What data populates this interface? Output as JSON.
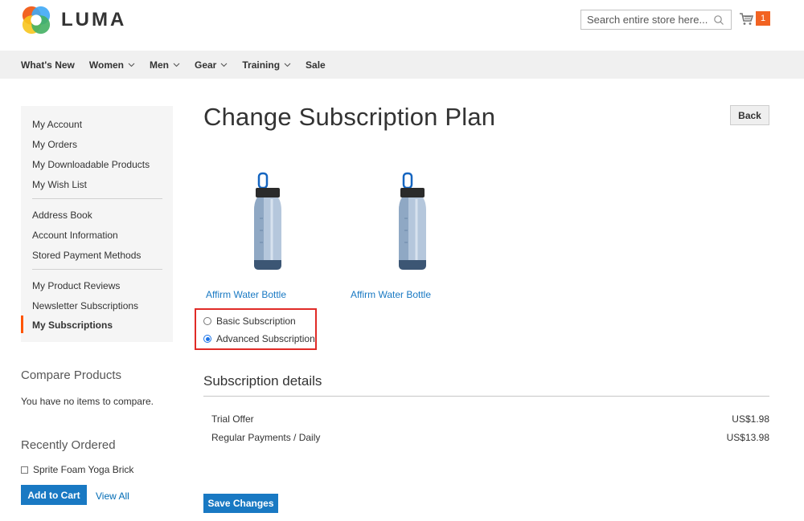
{
  "header": {
    "brand": "LUMA",
    "search_placeholder": "Search entire store here...",
    "cart_count": "1"
  },
  "nav": {
    "items": [
      {
        "label": "What's New",
        "has_dropdown": false
      },
      {
        "label": "Women",
        "has_dropdown": true
      },
      {
        "label": "Men",
        "has_dropdown": true
      },
      {
        "label": "Gear",
        "has_dropdown": true
      },
      {
        "label": "Training",
        "has_dropdown": true
      },
      {
        "label": "Sale",
        "has_dropdown": false
      }
    ]
  },
  "sidebar": {
    "items": [
      {
        "label": "My Account"
      },
      {
        "label": "My Orders"
      },
      {
        "label": "My Downloadable Products"
      },
      {
        "label": "My Wish List"
      },
      {
        "label": "Address Book"
      },
      {
        "label": "Account Information"
      },
      {
        "label": "Stored Payment Methods"
      },
      {
        "label": "My Product Reviews"
      },
      {
        "label": "Newsletter Subscriptions"
      },
      {
        "label": "My Subscriptions",
        "active": true
      }
    ]
  },
  "compare": {
    "title": "Compare Products",
    "empty_text": "You have no items to compare."
  },
  "recently_ordered": {
    "title": "Recently Ordered",
    "item": "Sprite Foam Yoga Brick",
    "add_to_cart": "Add to Cart",
    "view_all": "View All"
  },
  "main": {
    "title": "Change Subscription Plan",
    "back": "Back",
    "products": [
      {
        "name": "Affirm Water Bottle"
      },
      {
        "name": "Affirm Water Bottle"
      }
    ],
    "plans": [
      {
        "label": "Basic Subscription",
        "checked": false
      },
      {
        "label": "Advanced Subscription",
        "checked": true
      }
    ],
    "details_title": "Subscription details",
    "details": [
      {
        "label": "Trial Offer",
        "value": "US$1.98"
      },
      {
        "label": "Regular Payments / Daily",
        "value": "US$13.98"
      }
    ],
    "save": "Save Changes"
  },
  "colors": {
    "accent": "#1979c3",
    "link": "#006bb4",
    "highlight_border": "#e02b27",
    "active_marker": "#ff5501",
    "cart_badge": "#f26322"
  }
}
